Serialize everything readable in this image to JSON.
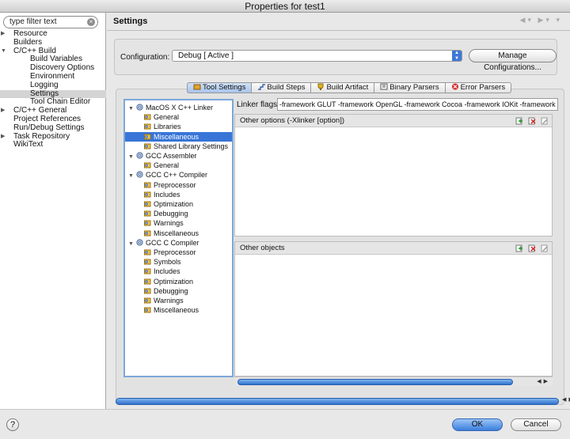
{
  "window": {
    "title": "Properties for test1"
  },
  "sidebar": {
    "filter_placeholder": "type filter text",
    "items": [
      {
        "label": "Resource",
        "level": 0,
        "expander": "collapsed"
      },
      {
        "label": "Builders",
        "level": 0,
        "expander": "none"
      },
      {
        "label": "C/C++ Build",
        "level": 0,
        "expander": "expanded"
      },
      {
        "label": "Build Variables",
        "level": 1,
        "expander": "none"
      },
      {
        "label": "Discovery Options",
        "level": 1,
        "expander": "none"
      },
      {
        "label": "Environment",
        "level": 1,
        "expander": "none"
      },
      {
        "label": "Logging",
        "level": 1,
        "expander": "none"
      },
      {
        "label": "Settings",
        "level": 1,
        "expander": "none",
        "selected": true
      },
      {
        "label": "Tool Chain Editor",
        "level": 1,
        "expander": "none"
      },
      {
        "label": "C/C++ General",
        "level": 0,
        "expander": "collapsed"
      },
      {
        "label": "Project References",
        "level": 0,
        "expander": "none"
      },
      {
        "label": "Run/Debug Settings",
        "level": 0,
        "expander": "none"
      },
      {
        "label": "Task Repository",
        "level": 0,
        "expander": "collapsed"
      },
      {
        "label": "WikiText",
        "level": 0,
        "expander": "none"
      }
    ]
  },
  "header": {
    "title": "Settings"
  },
  "configuration": {
    "label": "Configuration:",
    "value": "Debug  [ Active ]",
    "manage_button": "Manage Configurations..."
  },
  "tabs": [
    {
      "label": "Tool Settings",
      "active": true,
      "icon": "tool-settings-icon"
    },
    {
      "label": "Build Steps",
      "active": false,
      "icon": "build-steps-icon"
    },
    {
      "label": "Build Artifact",
      "active": false,
      "icon": "build-artifact-icon"
    },
    {
      "label": "Binary Parsers",
      "active": false,
      "icon": "binary-parsers-icon"
    },
    {
      "label": "Error Parsers",
      "active": false,
      "icon": "error-parsers-icon"
    }
  ],
  "tool_tree": [
    {
      "label": "MacOS X C++ Linker",
      "type": "tool",
      "level": 0
    },
    {
      "label": "General",
      "type": "category",
      "level": 1
    },
    {
      "label": "Libraries",
      "type": "category",
      "level": 1
    },
    {
      "label": "Miscellaneous",
      "type": "category",
      "level": 1,
      "selected": true
    },
    {
      "label": "Shared Library Settings",
      "type": "category",
      "level": 1
    },
    {
      "label": "GCC Assembler",
      "type": "tool",
      "level": 0
    },
    {
      "label": "General",
      "type": "category",
      "level": 1
    },
    {
      "label": "GCC C++ Compiler",
      "type": "tool",
      "level": 0
    },
    {
      "label": "Preprocessor",
      "type": "category",
      "level": 1
    },
    {
      "label": "Includes",
      "type": "category",
      "level": 1
    },
    {
      "label": "Optimization",
      "type": "category",
      "level": 1
    },
    {
      "label": "Debugging",
      "type": "category",
      "level": 1
    },
    {
      "label": "Warnings",
      "type": "category",
      "level": 1
    },
    {
      "label": "Miscellaneous",
      "type": "category",
      "level": 1
    },
    {
      "label": "GCC C Compiler",
      "type": "tool",
      "level": 0
    },
    {
      "label": "Preprocessor",
      "type": "category",
      "level": 1
    },
    {
      "label": "Symbols",
      "type": "category",
      "level": 1
    },
    {
      "label": "Includes",
      "type": "category",
      "level": 1
    },
    {
      "label": "Optimization",
      "type": "category",
      "level": 1
    },
    {
      "label": "Debugging",
      "type": "category",
      "level": 1
    },
    {
      "label": "Warnings",
      "type": "category",
      "level": 1
    },
    {
      "label": "Miscellaneous",
      "type": "category",
      "level": 1
    }
  ],
  "linker_flags": {
    "label": "Linker flags",
    "value": "-framework GLUT -framework OpenGL -framework Cocoa -framework IOKit -framework"
  },
  "other_options": {
    "title": "Other options (-Xlinker [option])"
  },
  "other_objects": {
    "title": "Other objects"
  },
  "footer": {
    "help": "?",
    "ok": "OK",
    "cancel": "Cancel"
  },
  "colors": {
    "selection": "#3875d7",
    "accent": "#3b7fde",
    "tree_border": "#7da7d9"
  }
}
